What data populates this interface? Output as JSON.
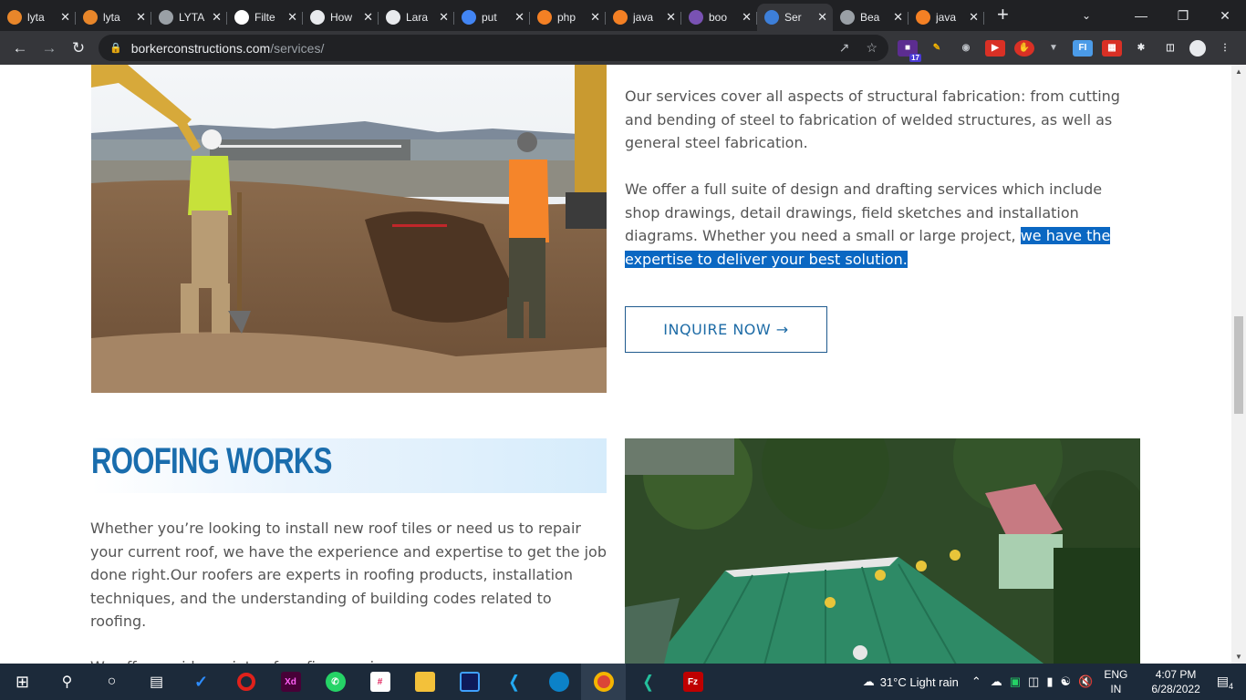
{
  "browser": {
    "tabs": [
      {
        "title": "lyta",
        "icon": "lytas-icon",
        "color": "#e8862a"
      },
      {
        "title": "lyta",
        "icon": "lytas-icon",
        "color": "#e8862a"
      },
      {
        "title": "LYTA",
        "icon": "globe-icon",
        "color": "#9aa0a6"
      },
      {
        "title": "Filte",
        "icon": "github-icon",
        "color": "#ffffff"
      },
      {
        "title": "How",
        "icon": "dots-icon",
        "color": "#e8eaed"
      },
      {
        "title": "Lara",
        "icon": "dots-icon",
        "color": "#e8eaed"
      },
      {
        "title": "put",
        "icon": "google-icon",
        "color": "#4285f4"
      },
      {
        "title": "php",
        "icon": "stackoverflow-icon",
        "color": "#f48024"
      },
      {
        "title": "java",
        "icon": "stackoverflow-icon",
        "color": "#f48024"
      },
      {
        "title": "boo",
        "icon": "bootstrap-icon",
        "color": "#7952b3"
      },
      {
        "title": "Ser",
        "icon": "site-icon",
        "color": "#3d7fd9",
        "active": true
      },
      {
        "title": "Bea",
        "icon": "globe-icon",
        "color": "#9aa0a6"
      },
      {
        "title": "java",
        "icon": "stackoverflow-icon",
        "color": "#f48024"
      }
    ],
    "url_domain": "borkerconstructions.com",
    "url_path": "/services/",
    "extension_badge": "17"
  },
  "content": {
    "structural_p1": "Our services cover all aspects of structural fabrication: from cutting and bending of steel to fabrication of welded structures, as well as general steel fabrication.",
    "structural_p2_start": "We offer a full suite of design and drafting services which include shop drawings, detail drawings, field sketches and installation diagrams. Whether you need a small or large project, ",
    "structural_p2_highlight": "we have the expertise to deliver your best solution.",
    "inquire_label": "INQUIRE NOW →",
    "roofing_heading": "ROOFING WORKS",
    "roofing_p1": "Whether you’re looking to install new roof tiles or need us to repair your current roof, we have the experience and expertise to get the job done right.Our roofers are experts in roofing products, installation techniques, and the understanding of building codes related to roofing.",
    "roofing_p2": "We offer a wide variety of roofing services"
  },
  "taskbar": {
    "weather": "31°C  Light rain",
    "lang_line1": "ENG",
    "lang_line2": "IN",
    "time": "4:07 PM",
    "date": "6/28/2022",
    "notifications": "4"
  },
  "colors": {
    "accent": "#1a6dad",
    "highlight": "#0a67c2"
  }
}
